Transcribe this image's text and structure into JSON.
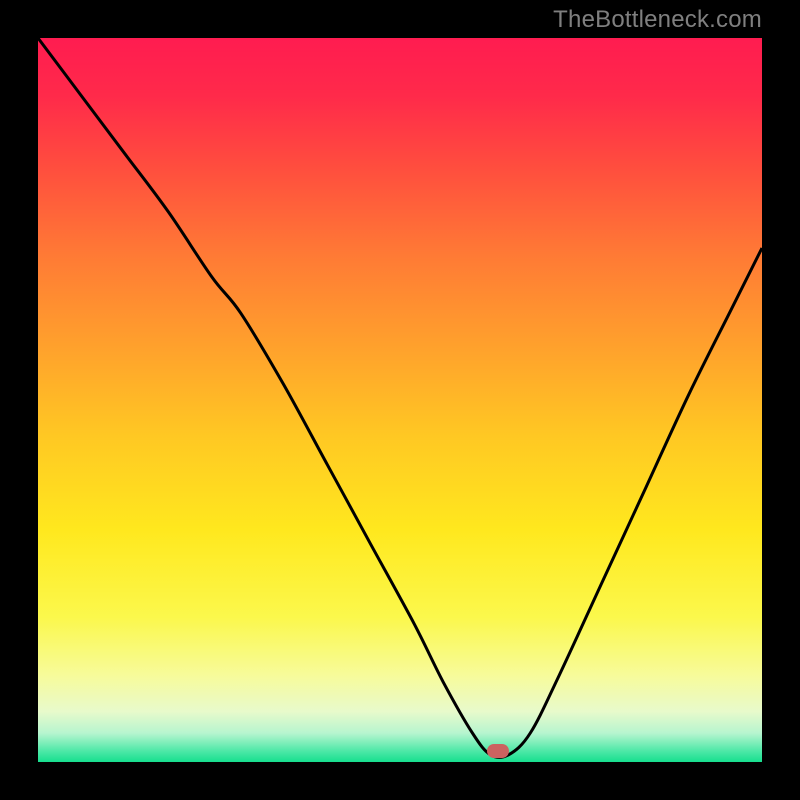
{
  "watermark": {
    "text": "TheBottleneck.com"
  },
  "colors": {
    "gradient_stops": [
      {
        "pos": 0.0,
        "color": "#ff1c50"
      },
      {
        "pos": 0.08,
        "color": "#ff2a4a"
      },
      {
        "pos": 0.18,
        "color": "#ff4e3e"
      },
      {
        "pos": 0.3,
        "color": "#ff7a35"
      },
      {
        "pos": 0.43,
        "color": "#ffa22c"
      },
      {
        "pos": 0.55,
        "color": "#ffc823"
      },
      {
        "pos": 0.68,
        "color": "#ffe81e"
      },
      {
        "pos": 0.8,
        "color": "#fbf84c"
      },
      {
        "pos": 0.88,
        "color": "#f7fb9a"
      },
      {
        "pos": 0.93,
        "color": "#e8facb"
      },
      {
        "pos": 0.96,
        "color": "#b7f5cf"
      },
      {
        "pos": 0.985,
        "color": "#4de8a7"
      },
      {
        "pos": 1.0,
        "color": "#17df8e"
      }
    ],
    "curve": "#000000",
    "marker": "#cb6260",
    "frame": "#000000"
  },
  "chart_data": {
    "type": "line",
    "title": "",
    "xlabel": "",
    "ylabel": "",
    "xlim": [
      0,
      100
    ],
    "ylim": [
      0,
      100
    ],
    "grid": false,
    "legend": false,
    "series": [
      {
        "name": "bottleneck-curve",
        "x": [
          0,
          6,
          12,
          18,
          24,
          28,
          34,
          40,
          46,
          52,
          56,
          60,
          62.5,
          65,
          68,
          72,
          78,
          84,
          90,
          96,
          100
        ],
        "y": [
          100,
          92,
          84,
          76,
          67,
          62,
          52,
          41,
          30,
          19,
          11,
          4,
          1,
          1,
          4,
          12,
          25,
          38,
          51,
          63,
          71
        ]
      }
    ],
    "marker": {
      "x": 63.5,
      "y": 1.5
    },
    "notes": "y is percentage-like (0 bottom, 100 top); curve dips to ~0 near x≈63 then rises."
  }
}
